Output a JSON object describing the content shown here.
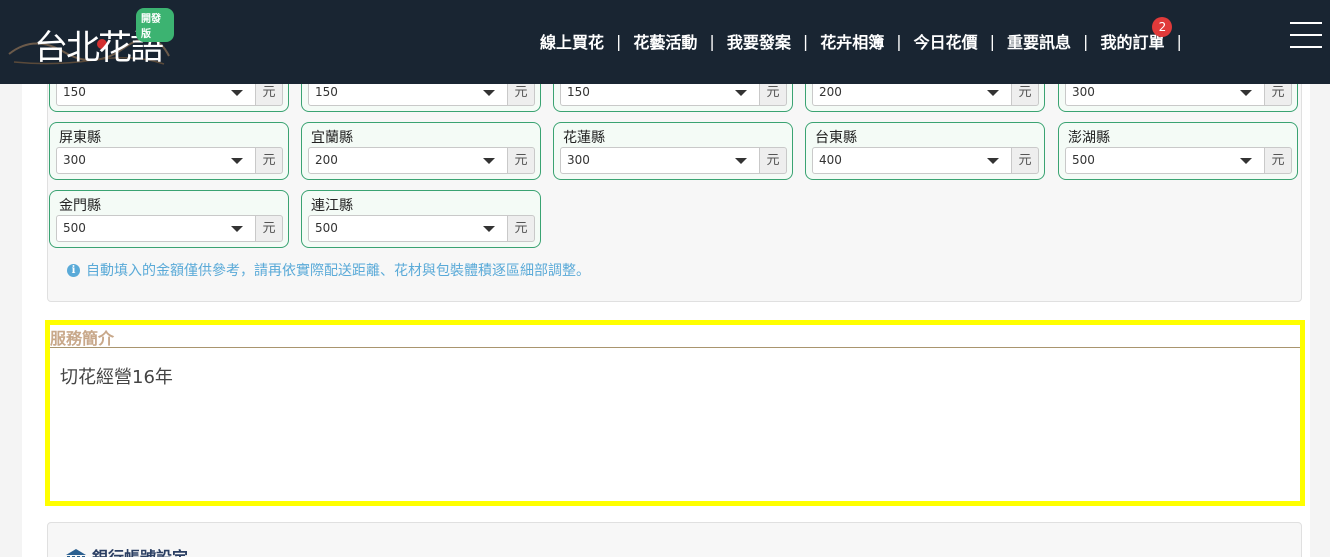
{
  "header": {
    "logo": "台北花語",
    "logo_badge": "開發版",
    "nav": [
      {
        "label": "線上買花"
      },
      {
        "label": "花藝活動"
      },
      {
        "label": "我要發案"
      },
      {
        "label": "花卉相簿"
      },
      {
        "label": "今日花價"
      },
      {
        "label": "重要訊息"
      },
      {
        "label": "我的訂單",
        "badge": "2"
      }
    ],
    "menu_icon": "hamburger-icon"
  },
  "fees": {
    "unit": "元",
    "row1": [
      {
        "value": "150"
      },
      {
        "value": "150"
      },
      {
        "value": "150"
      },
      {
        "value": "200"
      },
      {
        "value": "300"
      }
    ],
    "row2": [
      {
        "county": "屏東縣",
        "value": "300"
      },
      {
        "county": "宜蘭縣",
        "value": "200"
      },
      {
        "county": "花蓮縣",
        "value": "300"
      },
      {
        "county": "台東縣",
        "value": "400"
      },
      {
        "county": "澎湖縣",
        "value": "500"
      }
    ],
    "row3": [
      {
        "county": "金門縣",
        "value": "500"
      },
      {
        "county": "連江縣",
        "value": "500"
      }
    ],
    "note": "自動填入的金額僅供參考，請再依實際配送距離、花材與包裝體積逐區細部調整。"
  },
  "service": {
    "label": "服務簡介",
    "text": "切花經營16年"
  },
  "bank": {
    "title": "銀行帳號設定"
  },
  "colors": {
    "header_bg": "#192532",
    "card_border": "#3aa372",
    "highlight": "#ffff00",
    "note": "#5aaad8"
  }
}
